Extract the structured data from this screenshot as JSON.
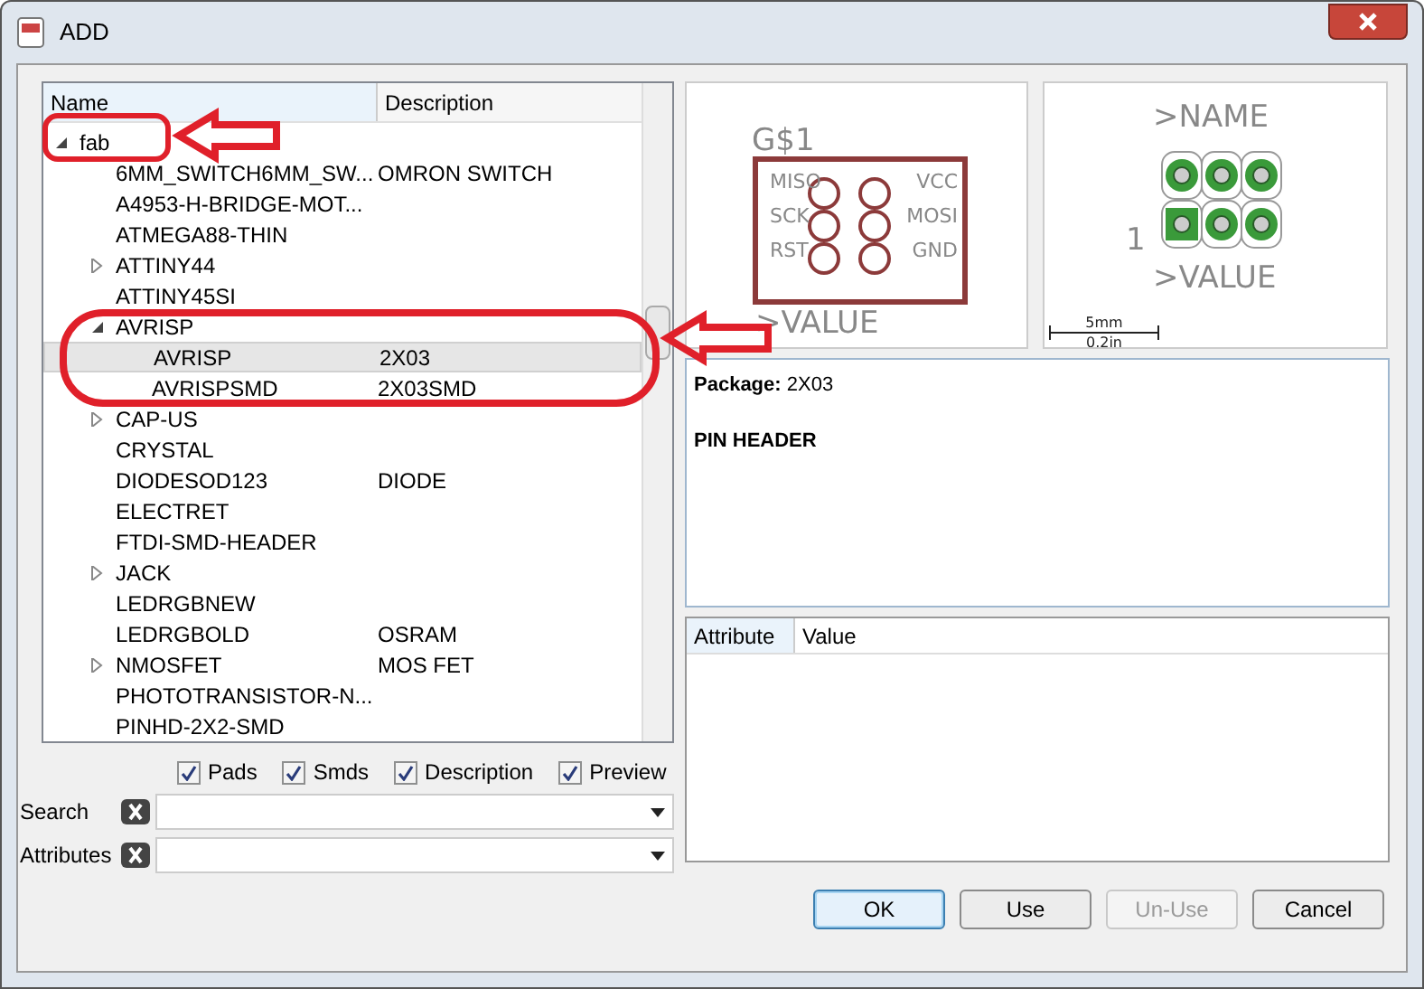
{
  "window": {
    "title": "ADD"
  },
  "tree": {
    "columns": [
      "Name",
      "Description"
    ],
    "items": [
      {
        "name": "fab",
        "expanded": true,
        "selected": false,
        "children": [
          {
            "name": "6MM_SWITCH6MM_SW...",
            "description": "OMRON SWITCH",
            "selected": false
          },
          {
            "name": "A4953-H-BRIDGE-MOT...",
            "selected": false
          },
          {
            "name": "ATMEGA88-THIN",
            "selected": false
          },
          {
            "name": "ATTINY44",
            "expanded": false,
            "selected": false
          },
          {
            "name": "ATTINY45SI",
            "selected": false
          },
          {
            "name": "AVRISP",
            "expanded": true,
            "selected": false,
            "children": [
              {
                "name": "AVRISP",
                "description": "2X03",
                "selected": true
              },
              {
                "name": "AVRISPSMD",
                "description": "2X03SMD",
                "selected": false
              }
            ]
          },
          {
            "name": "CAP-US",
            "expanded": false,
            "selected": false
          },
          {
            "name": "CRYSTAL",
            "selected": false
          },
          {
            "name": "DIODESOD123",
            "description": "DIODE",
            "selected": false
          },
          {
            "name": "ELECTRET",
            "selected": false
          },
          {
            "name": "FTDI-SMD-HEADER",
            "selected": false
          },
          {
            "name": "JACK",
            "expanded": false,
            "selected": false
          },
          {
            "name": "LEDRGBNEW",
            "selected": false
          },
          {
            "name": "LEDRGBOLD",
            "description": "OSRAM",
            "selected": false
          },
          {
            "name": "NMOSFET",
            "description": "MOS FET",
            "expanded": false,
            "selected": false
          },
          {
            "name": "PHOTOTRANSISTOR-N...",
            "selected": false
          },
          {
            "name": "PINHD-2X2-SMD",
            "selected": false
          }
        ]
      }
    ]
  },
  "symbol_preview": {
    "name": "G$1",
    "pins_left": [
      "MISO",
      "SCK",
      "RST"
    ],
    "pins_right": [
      "VCC",
      "MOSI",
      "GND"
    ],
    "value": ">VALUE"
  },
  "package_preview": {
    "name": ">NAME",
    "pin_one": "1",
    "value": ">VALUE",
    "scale_metric": "5mm",
    "scale_imperial": "0.2in"
  },
  "description": {
    "package": "**Package:** 2X03",
    "text": "PIN HEADER"
  },
  "attributes_table": {
    "columns": [
      "Attribute",
      "Value"
    ]
  },
  "filters": [
    {
      "label": "Pads",
      "checked": true
    },
    {
      "label": "Smds",
      "checked": true
    },
    {
      "label": "Description",
      "checked": true
    },
    {
      "label": "Preview",
      "checked": true
    }
  ],
  "search": {
    "label": "Search"
  },
  "attributes": {
    "label": "Attributes"
  },
  "buttons": [
    {
      "label": "OK",
      "disabled": false,
      "default": true
    },
    {
      "label": "Use",
      "disabled": false,
      "default": false
    },
    {
      "label": "Un-Use",
      "disabled": true,
      "default": false
    },
    {
      "label": "Cancel",
      "disabled": false,
      "default": false
    }
  ]
}
